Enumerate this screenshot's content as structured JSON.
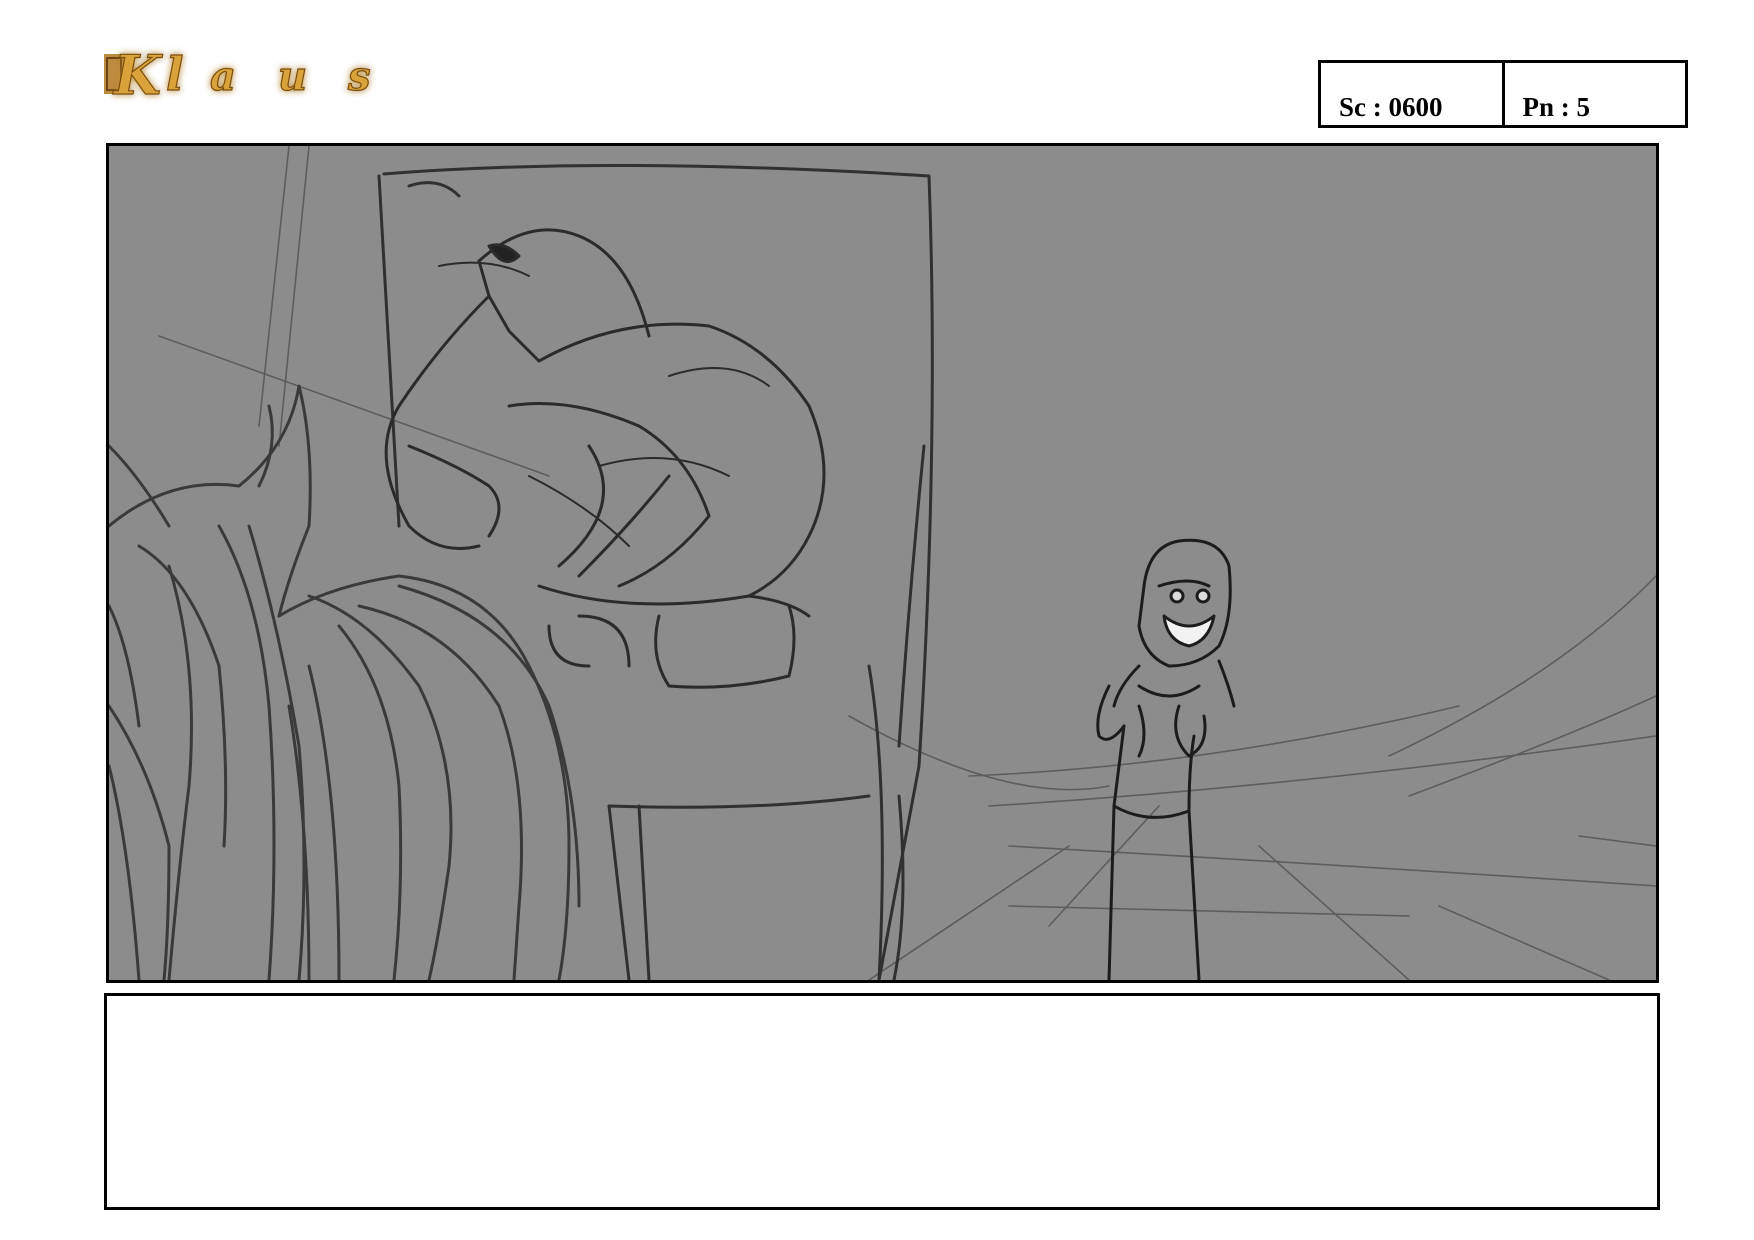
{
  "header": {
    "logo_text": "Klaus",
    "scene": "Sc : 0600",
    "panel_number": "Pn : 5"
  },
  "panel": {
    "background_color": "#8c8c8c",
    "line_color": "#2b2b2b",
    "sketch_subjects": [
      "seated-figure-on-throne-icon",
      "horse-head-icon",
      "grinning-hooded-figure-icon"
    ]
  },
  "notes": {
    "text": ""
  },
  "colors": {
    "logo_gold": "#d9a23a",
    "logo_glow": "#f2c777",
    "border": "#000000"
  }
}
